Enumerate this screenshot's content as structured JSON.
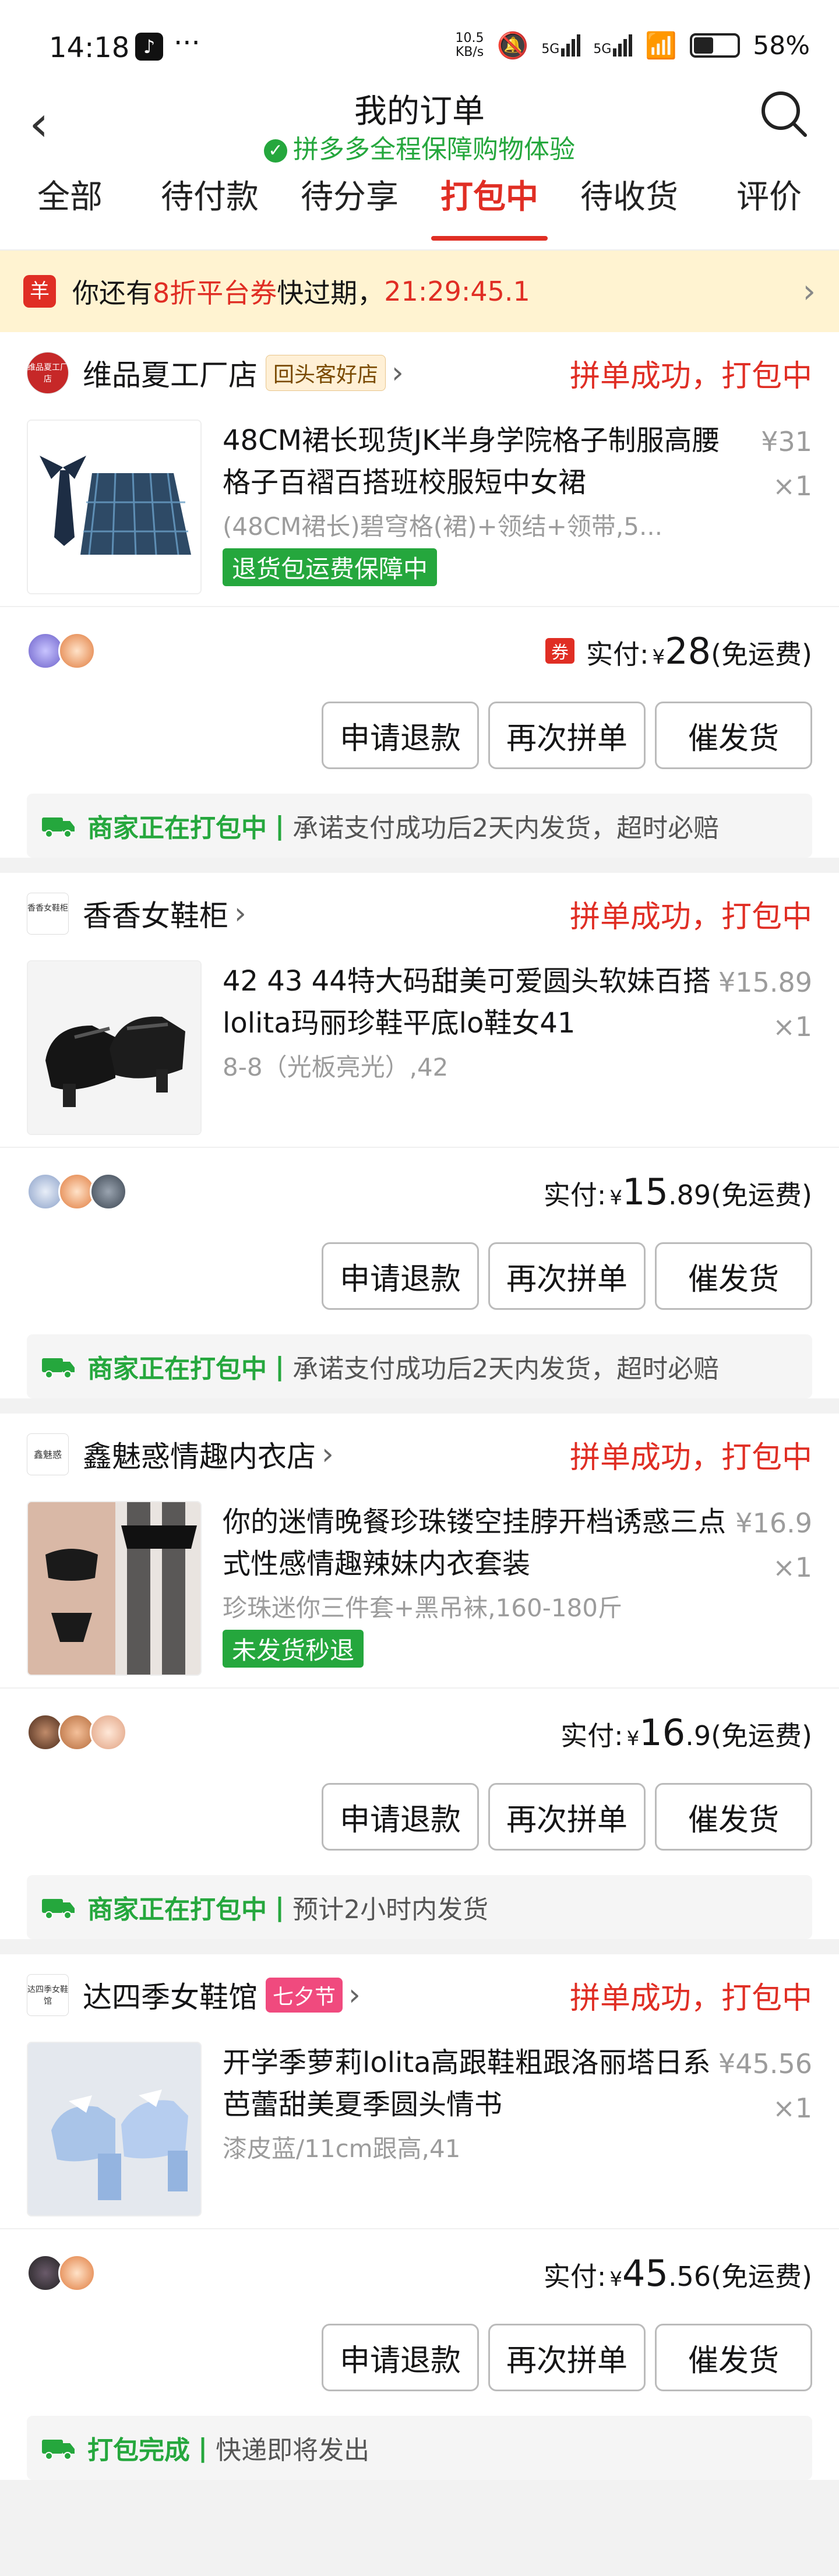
{
  "status_bar": {
    "time": "14:18",
    "dots": "···",
    "net_speed_1": "10.5",
    "net_speed_2": "KB/s",
    "signal_1": "5G",
    "signal_2": "5G",
    "battery": "58%"
  },
  "header": {
    "title": "我的订单",
    "subtitle": "拼多多全程保障购物体验",
    "back_icon": "‹"
  },
  "tabs": [
    "全部",
    "待付款",
    "待分享",
    "打包中",
    "待收货",
    "评价"
  ],
  "active_tab": 3,
  "coupon": {
    "icon": "羊",
    "prefix": "你还有",
    "highlight": "8折平台券",
    "middle": "快过期，",
    "countdown": "21:29:45.1"
  },
  "orders": [
    {
      "shop": "维品夏工厂店",
      "shop_logo": "维品夏工厂店",
      "tag": "回头客好店",
      "status": "拼单成功，打包中",
      "product": "48CM裙长现货JK半身学院格子制服高腰格子百褶百搭班校服短中女裙",
      "spec": "(48CM裙长)碧穹格(裙)+领结+领带,5...",
      "badge": "退货包运费保障中",
      "price": "¥31",
      "qty": "×1",
      "pay_label": "实付:",
      "pay_yen": "¥",
      "pay_int": "28",
      "pay_dec": "",
      "pay_note": "(免运费)",
      "ticket": "券",
      "buttons": [
        "申请退款",
        "再次拼单",
        "催发货"
      ],
      "notice_status": "商家正在打包中",
      "notice_text": "承诺支付成功后2天内发货，超时必赔"
    },
    {
      "shop": "香香女鞋柜",
      "shop_logo": "香香女鞋柜",
      "tag": "",
      "status": "拼单成功，打包中",
      "product": "42 43 44特大码甜美可爱圆头软妹百搭lolita玛丽珍鞋平底lo鞋女41",
      "spec": "8-8（光板亮光）,42",
      "badge": "",
      "price": "¥15.89",
      "qty": "×1",
      "pay_label": "实付:",
      "pay_yen": "¥",
      "pay_int": "15",
      "pay_dec": ".89",
      "pay_note": "(免运费)",
      "ticket": "",
      "buttons": [
        "申请退款",
        "再次拼单",
        "催发货"
      ],
      "notice_status": "商家正在打包中",
      "notice_text": "承诺支付成功后2天内发货，超时必赔"
    },
    {
      "shop": "鑫魅惑情趣内衣店",
      "shop_logo": "鑫魅惑",
      "tag": "",
      "status": "拼单成功，打包中",
      "product": "你的迷情晚餐珍珠镂空挂脖开档诱惑三点式性感情趣辣妹内衣套装",
      "spec": "珍珠迷你三件套+黑吊袜,160-180斤",
      "badge": "未发货秒退",
      "price": "¥16.9",
      "qty": "×1",
      "pay_label": "实付:",
      "pay_yen": "¥",
      "pay_int": "16",
      "pay_dec": ".9",
      "pay_note": "(免运费)",
      "ticket": "",
      "buttons": [
        "申请退款",
        "再次拼单",
        "催发货"
      ],
      "notice_status": "商家正在打包中",
      "notice_text": "预计2小时内发货"
    },
    {
      "shop": "达四季女鞋馆",
      "shop_logo": "达四季女鞋馆",
      "tag": "七夕节",
      "status": "拼单成功，打包中",
      "product": "开学季萝莉lolita高跟鞋粗跟洛丽塔日系芭蕾甜美夏季圆头情书",
      "spec": "漆皮蓝/11cm跟高,41",
      "badge": "",
      "price": "¥45.56",
      "qty": "×1",
      "pay_label": "实付:",
      "pay_yen": "¥",
      "pay_int": "45",
      "pay_dec": ".56",
      "pay_note": "(免运费)",
      "ticket": "",
      "buttons": [
        "申请退款",
        "再次拼单",
        "催发货"
      ],
      "notice_status": "打包完成",
      "notice_text": "快递即将发出"
    }
  ],
  "colors": {
    "accent": "#e02e24",
    "green": "#25a73d",
    "coupon_bg": "#fff3d1"
  }
}
